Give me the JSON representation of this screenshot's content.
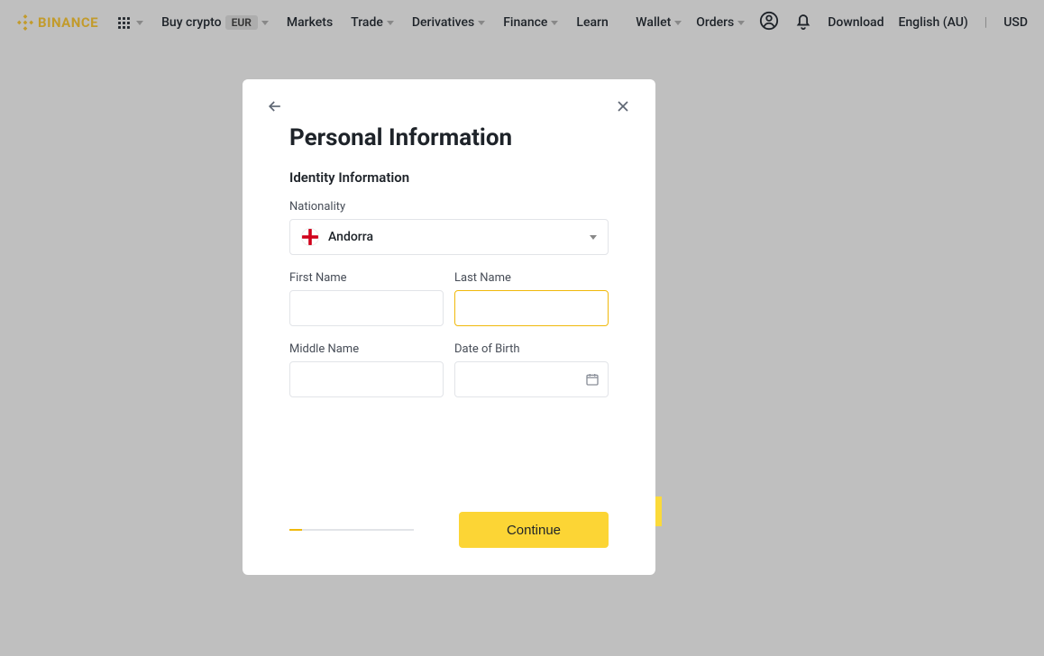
{
  "nav": {
    "logo_text": "BINANCE",
    "buy_crypto": "Buy crypto",
    "currency_pill": "EUR",
    "markets": "Markets",
    "trade": "Trade",
    "derivatives": "Derivatives",
    "finance": "Finance",
    "learn": "Learn",
    "wallet": "Wallet",
    "orders": "Orders",
    "download": "Download",
    "language": "English (AU)",
    "divider": "|",
    "currency": "USD"
  },
  "modal": {
    "title": "Personal Information",
    "section": "Identity Information",
    "nationality_label": "Nationality",
    "nationality_value": "Andorra",
    "first_name_label": "First Name",
    "last_name_label": "Last Name",
    "middle_name_label": "Middle Name",
    "dob_label": "Date of Birth",
    "continue": "Continue"
  }
}
